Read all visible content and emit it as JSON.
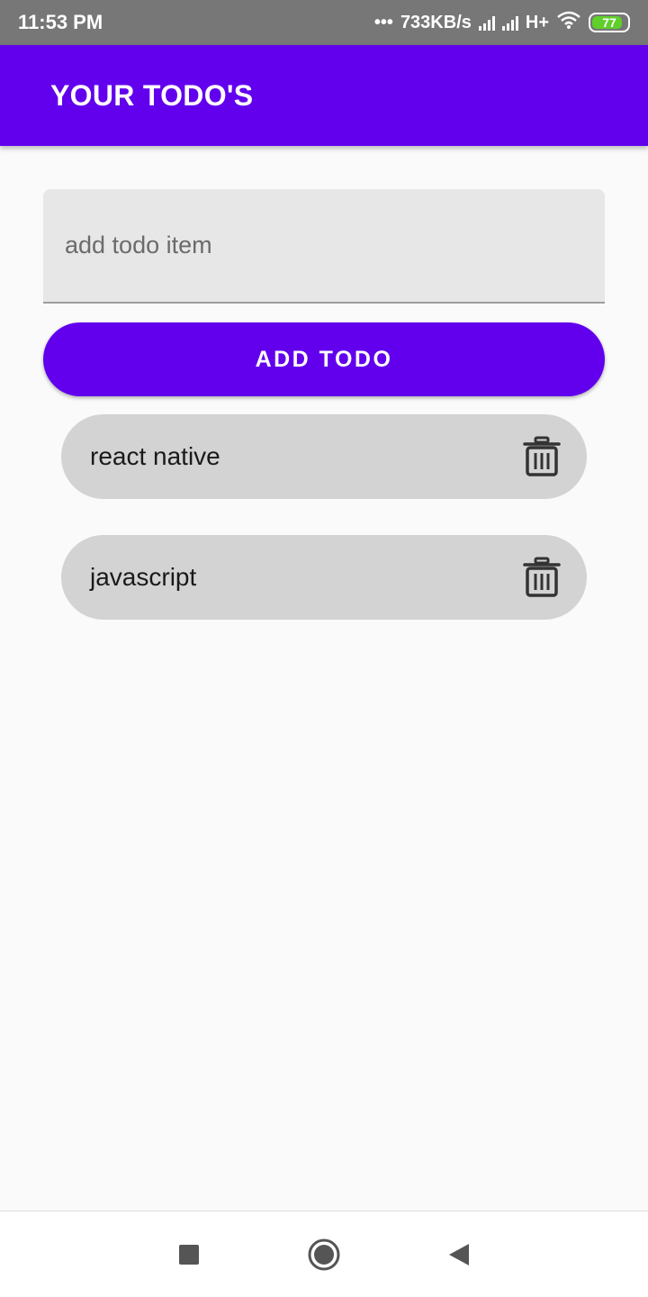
{
  "status_bar": {
    "time": "11:53 PM",
    "network_speed": "733KB/s",
    "network_type": "H+",
    "battery": "77",
    "battery_color": "#5fcf2a"
  },
  "app_bar": {
    "title": "YOUR TODO'S",
    "color": "#6200ee"
  },
  "todo_input": {
    "value": "",
    "placeholder": "add todo item"
  },
  "add_button": {
    "label": "ADD TODO"
  },
  "todos": [
    {
      "text": "react native",
      "delete_icon": "trash-icon"
    },
    {
      "text": "javascript",
      "delete_icon": "trash-icon"
    }
  ],
  "nav_bar": {
    "icons": [
      "recents-square-icon",
      "home-circle-icon",
      "back-triangle-icon"
    ]
  }
}
